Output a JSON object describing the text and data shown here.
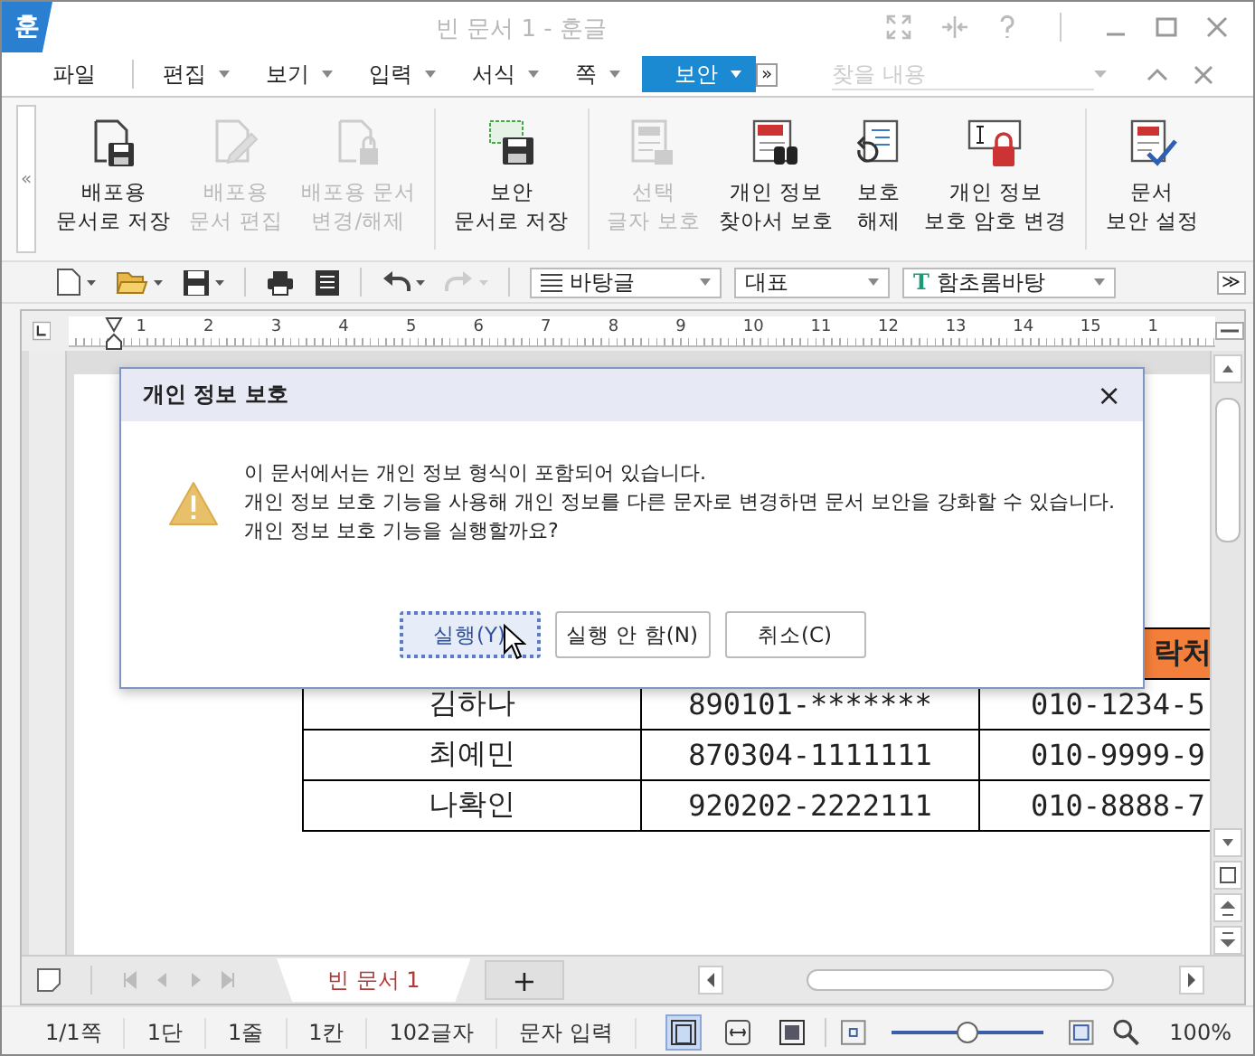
{
  "window": {
    "logo": "훈",
    "title": "빈 문서 1 - 훈글"
  },
  "menu": {
    "items": [
      {
        "label": "파일",
        "has_dropdown": false,
        "selected": false
      },
      {
        "label": "편집",
        "has_dropdown": true,
        "selected": false
      },
      {
        "label": "보기",
        "has_dropdown": true,
        "selected": false
      },
      {
        "label": "입력",
        "has_dropdown": true,
        "selected": false
      },
      {
        "label": "서식",
        "has_dropdown": true,
        "selected": false
      },
      {
        "label": "쪽",
        "has_dropdown": true,
        "selected": false
      },
      {
        "label": "보안",
        "has_dropdown": true,
        "selected": true
      }
    ],
    "more": "»",
    "search": {
      "placeholder": "찾을 내용"
    }
  },
  "ribbon": {
    "collapse": "«",
    "groups": [
      {
        "buttons": [
          {
            "label": "배포용\n문서로 저장",
            "kind": "savedoc",
            "disabled": false
          },
          {
            "label": "배포용\n문서 편집",
            "kind": "editdoc",
            "disabled": true
          },
          {
            "label": "배포용 문서\n변경/해제",
            "kind": "lockdoc",
            "disabled": true
          }
        ]
      },
      {
        "buttons": [
          {
            "label": "보안\n문서로 저장",
            "kind": "securesave",
            "disabled": false
          }
        ]
      },
      {
        "buttons": [
          {
            "label": "선택\n글자 보호",
            "kind": "textlock",
            "disabled": true
          },
          {
            "label": "개인 정보\n찾아서 보호",
            "kind": "find",
            "disabled": false
          },
          {
            "label": "보호\n해제",
            "kind": "unprotect",
            "disabled": false
          },
          {
            "label": "개인 정보\n보호 암호 변경",
            "kind": "password",
            "disabled": false
          }
        ]
      },
      {
        "buttons": [
          {
            "label": "문서\n보안 설정",
            "kind": "settings",
            "disabled": false
          }
        ]
      }
    ]
  },
  "toolbar": {
    "style": "바탕글",
    "outline": "대표",
    "font_icon": "T",
    "font": "함초롬바탕",
    "more": "≫"
  },
  "ruler": {
    "marks": [
      "1",
      "2",
      "3",
      "4",
      "5",
      "6",
      "7",
      "8",
      "9",
      "10",
      "11",
      "12",
      "13",
      "14",
      "15",
      "1"
    ]
  },
  "table": {
    "column_3_header": "락처",
    "rows": [
      [
        "김하나",
        "890101-*******",
        "010-1234-5"
      ],
      [
        "최예민",
        "870304-1111111",
        "010-9999-9"
      ],
      [
        "나확인",
        "920202-2222111",
        "010-8888-7"
      ]
    ]
  },
  "dialog": {
    "title": "개인 정보 보호",
    "close": "×",
    "message": [
      "이 문서에서는 개인 정보 형식이 포함되어 있습니다.",
      "개인 정보 보호 기능을 사용해 개인 정보를 다른 문자로 변경하면 문서 보안을 강화할 수 있습니다.",
      "개인 정보 보호 기능을 실행할까요?"
    ],
    "buttons": [
      {
        "label": "실행(Y)",
        "focused": true
      },
      {
        "label": "실행 안 함(N)",
        "focused": false
      },
      {
        "label": "취소(C)",
        "focused": false
      }
    ]
  },
  "tabs": {
    "items": [
      {
        "label": "빈 문서 1",
        "selected": true
      }
    ],
    "add": "+"
  },
  "status": {
    "items": [
      "1/1쪽",
      "1단",
      "1줄",
      "1칸",
      "102글자",
      "문자 입력"
    ],
    "views": [
      {
        "kind": "page",
        "selected": true
      },
      {
        "kind": "width",
        "selected": false
      },
      {
        "kind": "full",
        "selected": false
      }
    ],
    "zoom": {
      "level": 0.5,
      "reading": "100%"
    }
  }
}
